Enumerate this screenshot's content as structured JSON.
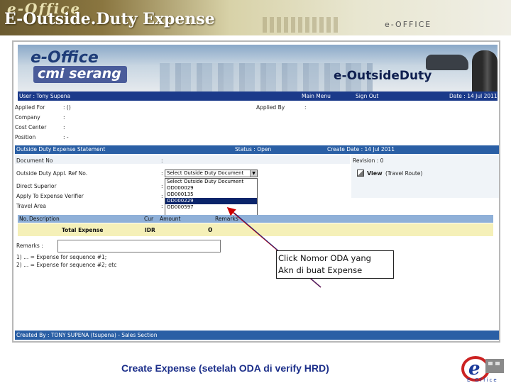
{
  "window": {
    "logo_text": "e-Office",
    "title": "E-Outside.Duty Expense",
    "right_logo": "e-OFFICE"
  },
  "banner": {
    "brand": "e-Office",
    "site": "cmi serang",
    "module": "e-OutsideDuty"
  },
  "nav": {
    "user": "User : Tony Supena",
    "main_menu": "Main Menu",
    "sign_out": "Sign Out",
    "date": "Date : 14 Jul 2011"
  },
  "info": {
    "applied_for_label": "Applied For",
    "applied_for_value": ": ()",
    "applied_by_label": "Applied By",
    "applied_by_value": ":",
    "company_label": "Company",
    "company_value": ":",
    "cost_center_label": "Cost Center",
    "cost_center_value": ":",
    "position_label": "Position",
    "position_value": ": -"
  },
  "statement": {
    "heading": "Outside Duty Expense Statement",
    "status": "Status : Open",
    "create_date": "Create Date : 14 Jul 2011"
  },
  "form": {
    "doc_no_label": "Document No",
    "doc_no_value": ":",
    "revision": "Revision : 0",
    "ref_no_label": "Outside Duty Appl. Ref No.",
    "ref_no_colon": ":",
    "select_value": "Select Outside Duty Document",
    "view_label": "View",
    "view_route": "(Travel Route)",
    "direct_superior_label": "Direct Superior",
    "direct_superior_colon": ":",
    "verifier_label": "Apply To Expense Verifier",
    "verifier_colon": ":",
    "travel_area_label": "Travel Area",
    "travel_area_colon": ":"
  },
  "dropdown_options": [
    {
      "label": "Select Outside Duty Document",
      "selected": false
    },
    {
      "label": "OD000029",
      "selected": false
    },
    {
      "label": "OD000135",
      "selected": false
    },
    {
      "label": "OD000229",
      "selected": true
    },
    {
      "label": "OD000597",
      "selected": false
    }
  ],
  "table": {
    "headers": {
      "no": "No.",
      "description": "Description",
      "cur": "Cur",
      "amount": "Amount",
      "remarks": "Remarks"
    },
    "total_label": "Total Expense",
    "total_cur": "IDR",
    "total_amount": "0"
  },
  "remarks": {
    "label": "Remarks :",
    "note1": "1) ... = Expense for sequence #1;",
    "note2": "2) ... = Expense for sequence #2; etc"
  },
  "footer": {
    "created_by": "Created By : TONY SUPENA (tsupena) - Sales Section"
  },
  "callout": {
    "line1": "Click Nomor ODA yang",
    "line2": "Akn di buat Expense"
  },
  "caption": "Create Expense (setelah ODA di verify HRD)",
  "brand_logo": {
    "text": "E-Office",
    "icon": "e-office-logo-icon"
  },
  "colors": {
    "nav": "#1b3a8a",
    "section_bar": "#2a5fa5",
    "table_header": "#8fb0d8",
    "total_row": "#f5f0b8",
    "caption": "#1c2f8a",
    "arrow": "#cc0000"
  }
}
